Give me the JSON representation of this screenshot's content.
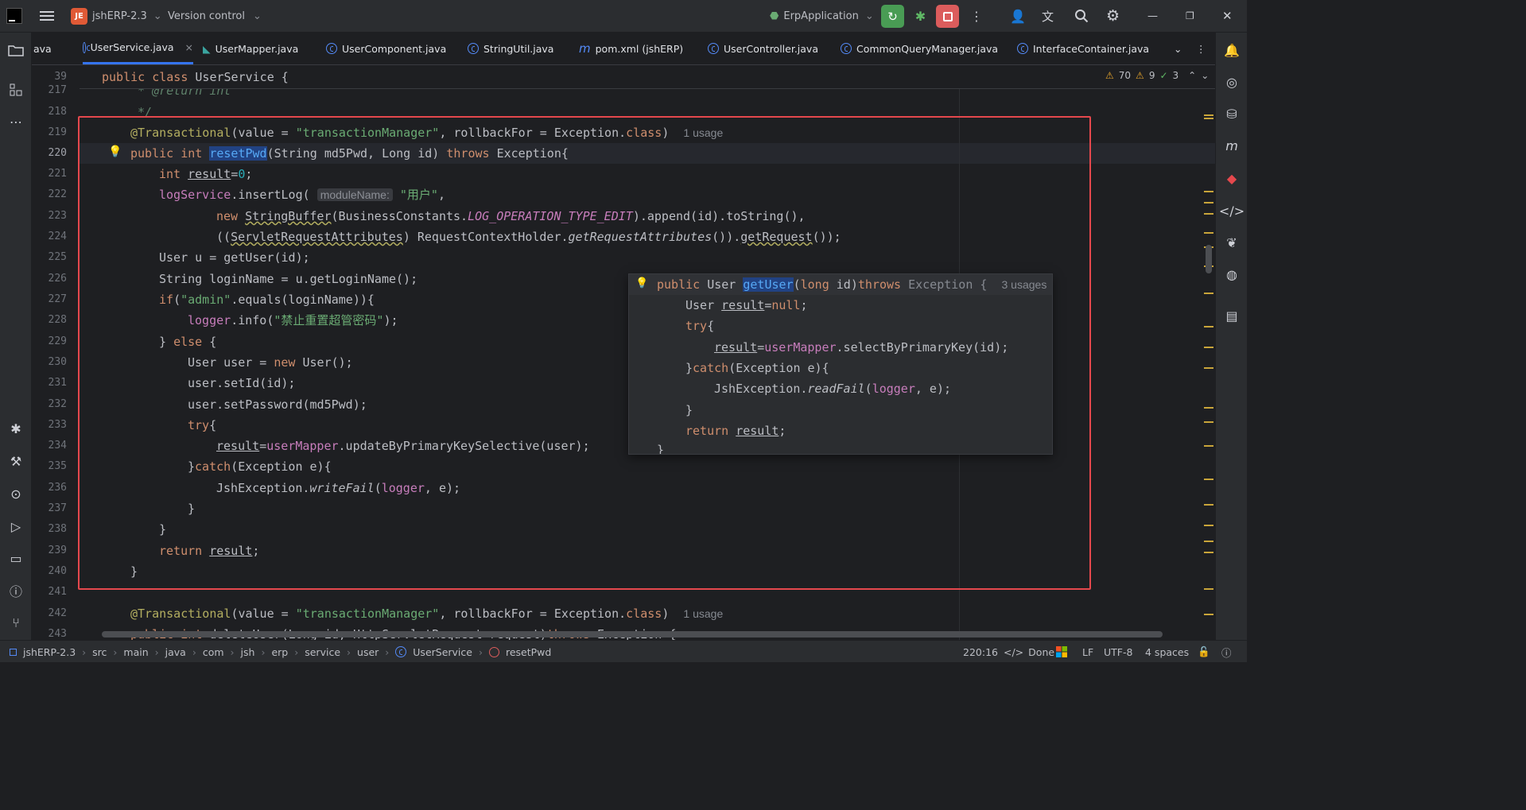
{
  "titlebar": {
    "project_badge": "JE",
    "project_name": "jshERP-2.3",
    "vcs_label": "Version control",
    "run_config": "ErpApplication"
  },
  "tabs": [
    {
      "label": "ava",
      "active": false
    },
    {
      "label": "UserService.java",
      "active": true
    },
    {
      "label": "UserMapper.java",
      "active": false
    },
    {
      "label": "UserComponent.java",
      "active": false
    },
    {
      "label": "StringUtil.java",
      "active": false
    },
    {
      "label": "pom.xml (jshERP)",
      "active": false
    },
    {
      "label": "UserController.java",
      "active": false
    },
    {
      "label": "CommonQueryManager.java",
      "active": false
    },
    {
      "label": "InterfaceContainer.java",
      "active": false
    }
  ],
  "inspections": {
    "warnings": "70",
    "weak_warnings": "9",
    "ok": "3"
  },
  "editor": {
    "sticky_line_number": "39",
    "sticky_text": "public class UserService {",
    "line_numbers": [
      "217",
      "218",
      "219",
      "220",
      "221",
      "222",
      "223",
      "224",
      "225",
      "226",
      "227",
      "228",
      "229",
      "230",
      "231",
      "232",
      "233",
      "234",
      "235",
      "236",
      "237",
      "238",
      "239",
      "240",
      "241",
      "242",
      "243"
    ],
    "usage_hint": "1 usage",
    "inlay_hint": "moduleName:",
    "literals": {
      "tx_manager": "\"transactionManager\"",
      "user_cn": "\"用户\"",
      "admin": "\"admin\"",
      "reset_msg": "\"禁止重置超管密码\""
    }
  },
  "popup": {
    "usages": "3 usages"
  },
  "status": {
    "breadcrumb": [
      "jshERP-2.3",
      "src",
      "main",
      "java",
      "com",
      "jsh",
      "erp",
      "service",
      "user",
      "UserService",
      "resetPwd"
    ],
    "position": "220:16",
    "ai_status": "Done",
    "line_sep": "LF",
    "encoding": "UTF-8",
    "indent": "4 spaces"
  },
  "colors": {
    "accent": "#3574f0",
    "highlight_box": "#e5484d",
    "run_green": "#499c54",
    "stop_red": "#db5c5c"
  }
}
